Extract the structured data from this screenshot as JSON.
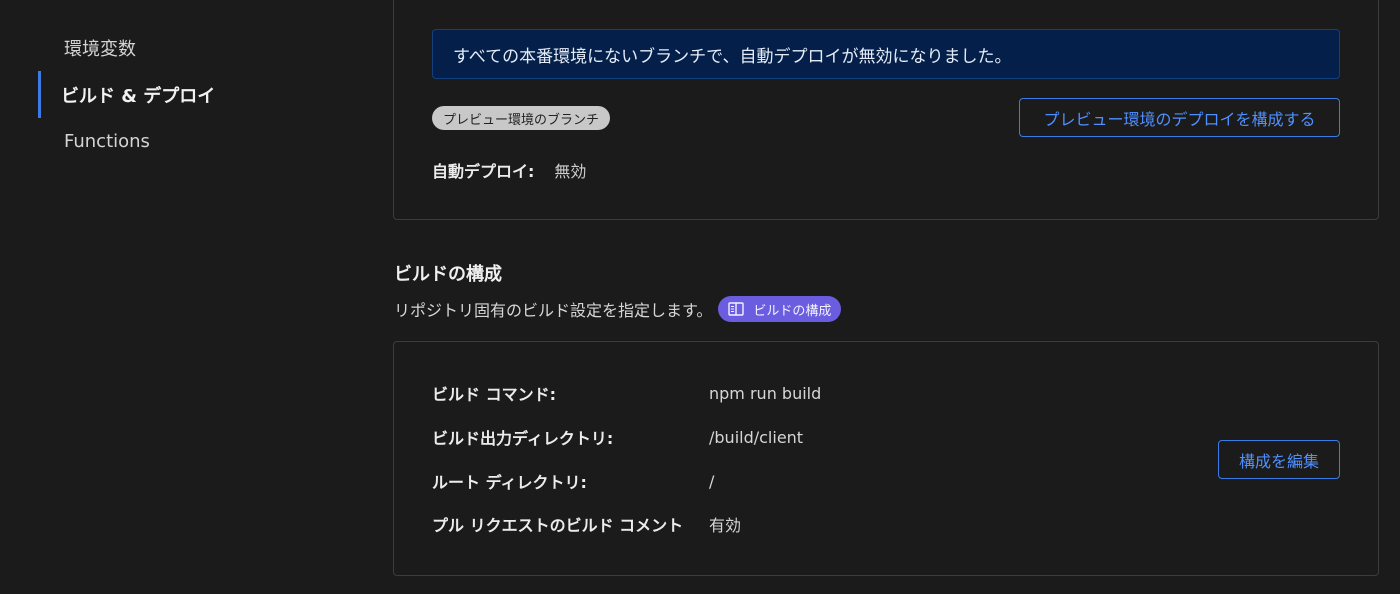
{
  "sidebar": {
    "items": [
      {
        "label": "環境変数",
        "active": false
      },
      {
        "label": "ビルド & デプロイ",
        "active": true
      },
      {
        "label": "Functions",
        "active": false
      }
    ]
  },
  "preview_card": {
    "banner": "すべての本番環境にないブランチで、自動デプロイが無効になりました。",
    "branch_tag": "プレビュー環境のブランチ",
    "configure_button": "プレビュー環境のデプロイを構成する",
    "auto_deploy_label": "自動デプロイ:",
    "auto_deploy_value": "無効"
  },
  "build_config": {
    "title": "ビルドの構成",
    "description": "リポジトリ固有のビルド設定を指定します。",
    "doc_link": "ビルドの構成",
    "rows": [
      {
        "label": "ビルド コマンド:",
        "value": "npm run build"
      },
      {
        "label": "ビルド出力ディレクトリ:",
        "value": "/build/client"
      },
      {
        "label": "ルート ディレクトリ:",
        "value": "/"
      },
      {
        "label": "プル リクエストのビルド コメント",
        "value": "有効"
      }
    ],
    "edit_button": "構成を編集"
  },
  "colors": {
    "accent": "#3b7be6",
    "banner_bg": "#04204a",
    "doc_pill": "#6b5de0",
    "background": "#1b1b1b"
  },
  "icons": {
    "doc_link": "book-icon"
  }
}
